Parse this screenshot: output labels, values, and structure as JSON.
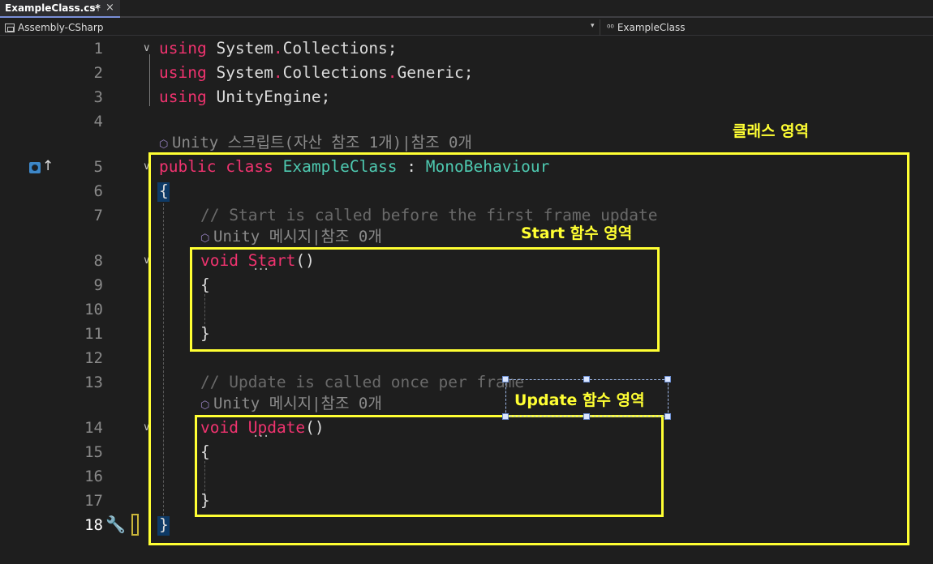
{
  "tab": {
    "label": "ExampleClass.cs*",
    "pin_glyph": "⊣",
    "close_glyph": "×"
  },
  "navbar": {
    "project": "Assembly-CSharp",
    "member_prefix": "⁰⁰",
    "member": "ExampleClass"
  },
  "lines": {
    "l1": "1",
    "l2": "2",
    "l3": "3",
    "l4": "4",
    "l5": "5",
    "l6": "6",
    "l7": "7",
    "l8": "8",
    "l9": "9",
    "l10": "10",
    "l11": "11",
    "l12": "12",
    "l13": "13",
    "l14": "14",
    "l15": "15",
    "l16": "16",
    "l17": "17",
    "l18": "18"
  },
  "code": {
    "using": "using",
    "system": "System",
    "dot": ".",
    "collections": "Collections",
    "generic": "Generic",
    "unityengine": "UnityEngine",
    "semicolon": ";",
    "public": "public",
    "class": "class",
    "class_name": "ExampleClass",
    "colon": " : ",
    "base": "MonoBehaviour",
    "open_brace": "{",
    "close_brace": "}",
    "comment_start": "// Start is called before the first frame update",
    "comment_update": "// Update is called once per frame",
    "void": "void",
    "start_fn": "Start",
    "update_fn": "Update",
    "parens": "()"
  },
  "codelens": {
    "class_lens": "Unity 스크립트(자산 참조 1개)|참조 0개",
    "start_lens": "Unity 메시지|참조 0개",
    "update_lens": "Unity 메시지|참조 0개",
    "icon": "cube-icon"
  },
  "annotations": {
    "class_region": "클래스 영역",
    "start_region": "Start 함수 영역",
    "update_region": "Update 함수 영역"
  },
  "colors": {
    "keyword": "#f0336f",
    "type": "#4ec9b0",
    "comment": "#6a6a6a",
    "annotation": "#ffff33",
    "background": "#1e1e1e"
  }
}
